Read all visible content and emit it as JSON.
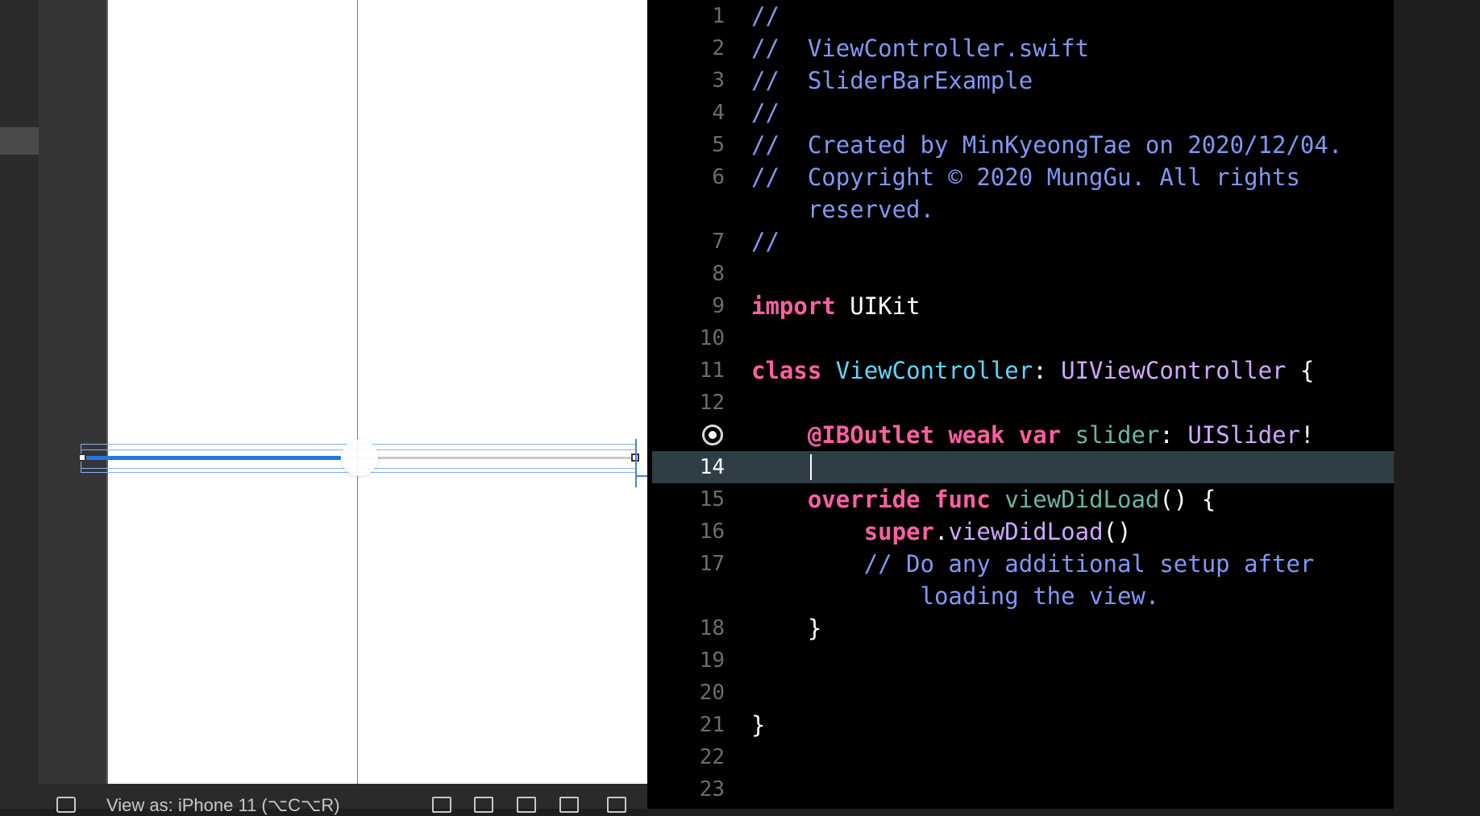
{
  "canvas": {
    "bottom_bar": {
      "view_as_label": "View as: iPhone 11 (⌥C⌥R)"
    }
  },
  "editor": {
    "lines": [
      {
        "n": "1",
        "tokens": [
          {
            "t": "//",
            "c": "cmt"
          }
        ]
      },
      {
        "n": "2",
        "tokens": [
          {
            "t": "//  ViewController.swift",
            "c": "cmt"
          }
        ]
      },
      {
        "n": "3",
        "tokens": [
          {
            "t": "//  SliderBarExample",
            "c": "cmt"
          }
        ]
      },
      {
        "n": "4",
        "tokens": [
          {
            "t": "//",
            "c": "cmt"
          }
        ]
      },
      {
        "n": "5",
        "tokens": [
          {
            "t": "//  Created by MinKyeongTae on 2020/12/04.",
            "c": "cmt"
          }
        ]
      },
      {
        "n": "6",
        "tokens": [
          {
            "t": "//  Copyright © 2020 MungGu. All rights",
            "c": "cmt"
          }
        ]
      },
      {
        "n": "",
        "tokens": [
          {
            "t": "    reserved.",
            "c": "cmt"
          }
        ]
      },
      {
        "n": "7",
        "tokens": [
          {
            "t": "//",
            "c": "cmt"
          }
        ]
      },
      {
        "n": "8",
        "tokens": []
      },
      {
        "n": "9",
        "tokens": [
          {
            "t": "import",
            "c": "kw"
          },
          {
            "t": " UIKit",
            "c": "plain"
          }
        ]
      },
      {
        "n": "10",
        "tokens": []
      },
      {
        "n": "11",
        "tokens": [
          {
            "t": "class",
            "c": "kw"
          },
          {
            "t": " ",
            "c": "plain"
          },
          {
            "t": "ViewController",
            "c": "cls"
          },
          {
            "t": ": ",
            "c": "plain"
          },
          {
            "t": "UIViewController",
            "c": "typ"
          },
          {
            "t": " {",
            "c": "plain"
          }
        ]
      },
      {
        "n": "12",
        "tokens": []
      },
      {
        "n": "",
        "bp": true,
        "tokens": [
          {
            "t": "    ",
            "c": "plain"
          },
          {
            "t": "@IBOutlet",
            "c": "kw"
          },
          {
            "t": " ",
            "c": "plain"
          },
          {
            "t": "weak",
            "c": "kw"
          },
          {
            "t": " ",
            "c": "plain"
          },
          {
            "t": "var",
            "c": "kw"
          },
          {
            "t": " ",
            "c": "plain"
          },
          {
            "t": "slider",
            "c": "fn"
          },
          {
            "t": ": ",
            "c": "plain"
          },
          {
            "t": "UISlider",
            "c": "typ"
          },
          {
            "t": "!",
            "c": "plain"
          }
        ]
      },
      {
        "n": "14",
        "active": true,
        "tokens": []
      },
      {
        "n": "15",
        "tokens": [
          {
            "t": "    ",
            "c": "plain"
          },
          {
            "t": "override",
            "c": "kw"
          },
          {
            "t": " ",
            "c": "plain"
          },
          {
            "t": "func",
            "c": "kw"
          },
          {
            "t": " ",
            "c": "plain"
          },
          {
            "t": "viewDidLoad",
            "c": "fn"
          },
          {
            "t": "() {",
            "c": "plain"
          }
        ]
      },
      {
        "n": "16",
        "tokens": [
          {
            "t": "        ",
            "c": "plain"
          },
          {
            "t": "super",
            "c": "kw"
          },
          {
            "t": ".",
            "c": "plain"
          },
          {
            "t": "viewDidLoad",
            "c": "typ"
          },
          {
            "t": "()",
            "c": "plain"
          }
        ]
      },
      {
        "n": "17",
        "tokens": [
          {
            "t": "        // Do any additional setup after",
            "c": "cmt"
          }
        ]
      },
      {
        "n": "",
        "tokens": [
          {
            "t": "            loading the view.",
            "c": "cmt"
          }
        ]
      },
      {
        "n": "18",
        "tokens": [
          {
            "t": "    }",
            "c": "plain"
          }
        ]
      },
      {
        "n": "19",
        "tokens": []
      },
      {
        "n": "20",
        "tokens": []
      },
      {
        "n": "21",
        "tokens": [
          {
            "t": "}",
            "c": "plain"
          }
        ]
      },
      {
        "n": "22",
        "tokens": []
      },
      {
        "n": "23",
        "tokens": []
      }
    ]
  },
  "slider": {
    "value": 0.45
  }
}
